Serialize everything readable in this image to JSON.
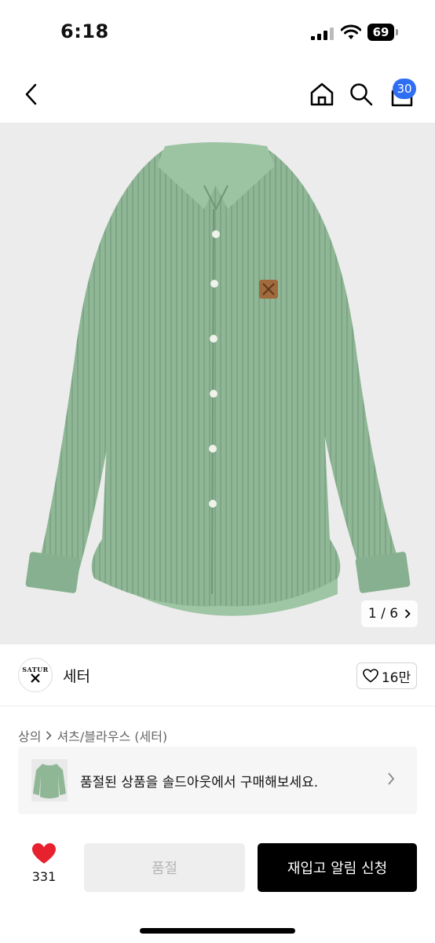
{
  "status_bar": {
    "time": "6:18",
    "battery": "69"
  },
  "header": {
    "cart_count": "30"
  },
  "gallery": {
    "current": "1",
    "total": "6",
    "separator": "/"
  },
  "brand": {
    "logo_text": "SATUR",
    "name": "세터",
    "likes": "16만"
  },
  "breadcrumb": {
    "level1": "상의",
    "level2": "셔츠/블라우스 (세터)"
  },
  "soldout_banner": {
    "text": "품절된 상품을 솔드아웃에서 구매해보세요."
  },
  "bottom_bar": {
    "wish_count": "331",
    "soldout_label": "품절",
    "restock_label": "재입고 알림 신청"
  },
  "colors": {
    "accent_badge": "#2f6ef2",
    "heart": "#e8212e",
    "shirt": "#8fb796"
  }
}
